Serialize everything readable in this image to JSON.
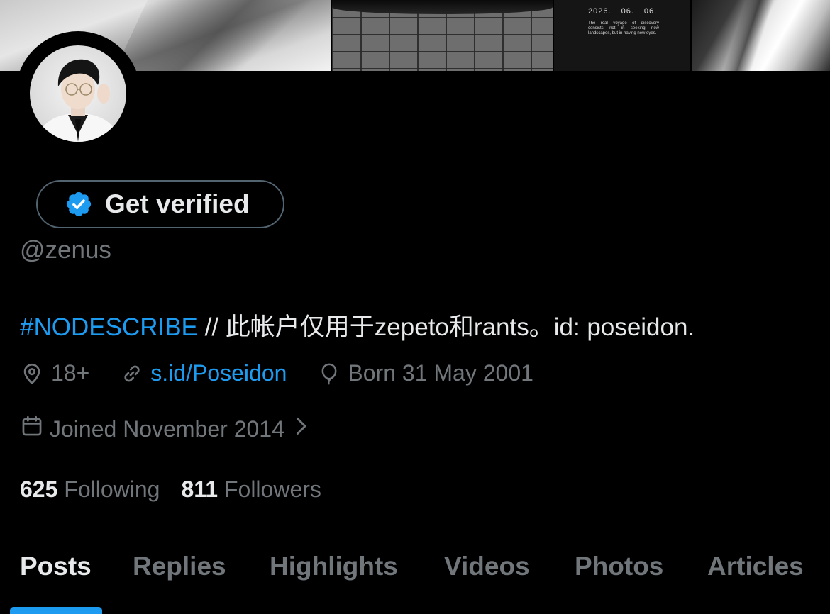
{
  "banner": {
    "date": "2026.  06.  06.",
    "quote": "The real voyage of discovery consists not in seeking new landscapes, but in having new eyes."
  },
  "profile": {
    "verify_label": "Get verified",
    "handle": "@zenus",
    "bio_hashtag": "#NODESCRIBE",
    "bio_text": " // 此帐户仅用于zepeto和rants。id: poseidon.",
    "location": "18+",
    "website": "s.id/Poseidon",
    "birthday": "Born 31 May 2001",
    "joined": "Joined November 2014",
    "following_count": "625",
    "following_label": "Following",
    "followers_count": "811",
    "followers_label": "Followers"
  },
  "tabs": [
    "Posts",
    "Replies",
    "Highlights",
    "Videos",
    "Photos",
    "Articles"
  ],
  "active_tab": "Posts",
  "colors": {
    "background": "#000000",
    "accent": "#1d9bf0",
    "text_primary": "#e7e9ea",
    "text_secondary": "#71767b",
    "border": "#536471"
  },
  "icons": {
    "verify": "verified-badge-icon",
    "location": "location-pin-icon",
    "link": "link-icon",
    "birthday": "balloon-icon",
    "joined": "calendar-icon",
    "chevron": "chevron-right-icon"
  }
}
